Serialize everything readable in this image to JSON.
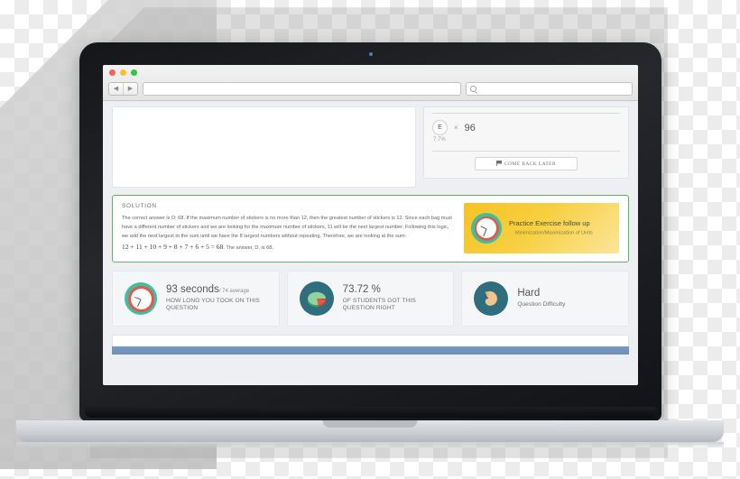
{
  "browser": {
    "traffic_lights": [
      "close-red",
      "minimize-yellow",
      "maximize-green"
    ],
    "back_glyph": "◀",
    "forward_glyph": "▶",
    "url_value": "",
    "url_placeholder": "",
    "search_value": "",
    "search_placeholder": ""
  },
  "answer_panel": {
    "choice_letter": "E",
    "times_symbol": "×",
    "count": "96",
    "percent": "7.7%",
    "come_back_label": "COME BACK LATER"
  },
  "solution": {
    "title": "SOLUTION",
    "body": "The correct answer is D; 68. If the maximum number of stickers is no more than 12, then the greatest number of stickers is 12. Since each bag must have a different number of stickers and we are looking for the maximum number of stickers, 11 will be the next largest number. Following this logic, we add the next largest to the sum until we have the 8 largest numbers without repeating. Therefore, we are looking at the sum:",
    "equation": "12 + 11 + 10 + 9 + 8 + 7 + 6 + 5 = 68",
    "equation_tail": ". The answer, D, is 68.",
    "border_color": "#5fb55f"
  },
  "practice": {
    "title": "Practice Exercise follow up",
    "subtitle": "Minimization/Maximization of Units",
    "bg_color": "#f5c325"
  },
  "stats": [
    {
      "icon": "clock-icon",
      "value": "93 seconds",
      "value_sub": "/ 74 average",
      "caption": "HOW LONG YOU TOOK ON THIS QUESTION"
    },
    {
      "icon": "pie-chart-icon",
      "value": "73.72 %",
      "value_sub": "",
      "caption": "OF STUDENTS GOT THIS QUESTION RIGHT"
    },
    {
      "icon": "muscle-icon",
      "value": "Hard",
      "value_sub": "",
      "caption": "Question Difficulty"
    }
  ],
  "footer": {
    "bar_color": "#6e8fbb"
  }
}
